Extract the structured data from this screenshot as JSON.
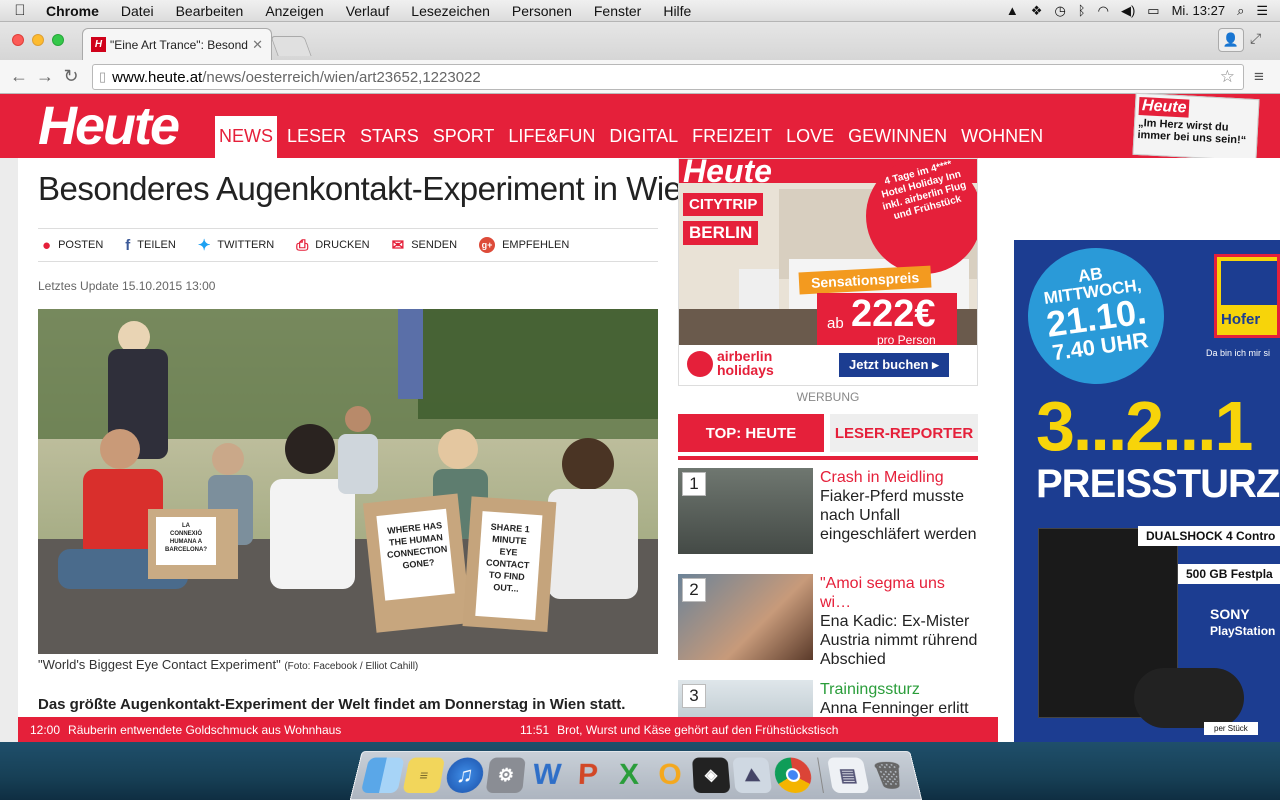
{
  "menubar": {
    "app": "Chrome",
    "items": [
      "Datei",
      "Bearbeiten",
      "Anzeigen",
      "Verlauf",
      "Lesezeichen",
      "Personen",
      "Fenster",
      "Hilfe"
    ],
    "clock": "Mi. 13:27"
  },
  "browser": {
    "tab_title": "\"Eine Art Trance\": Besonder",
    "tab_favicon": "H",
    "url_host": "www.heute.at",
    "url_path": "/news/oesterreich/wien/art23652,1223022"
  },
  "site": {
    "logo": "Heute",
    "nav": [
      "NEWS",
      "LESER",
      "STARS",
      "SPORT",
      "LIFE&FUN",
      "DIGITAL",
      "FREIZEIT",
      "LOVE",
      "GEWINNEN",
      "WOHNEN"
    ],
    "paper_logo": "Heute",
    "paper_headline": "„Im Herz wirst du immer bei uns sein!“"
  },
  "article": {
    "headline": "Besonderes Augenkontakt-Experiment in Wien",
    "share": [
      "POSTEN",
      "TEILEN",
      "TWITTERN",
      "DRUCKEN",
      "SENDEN",
      "EMPFEHLEN"
    ],
    "updated": "Letztes Update 15.10.2015 13:00",
    "caption": "\"World's Biggest Eye Contact Experiment\"",
    "caption_credit": "(Foto: Facebook / Elliot Cahill)",
    "lead": "Das größte Augenkontakt-Experiment der Welt findet am Donnerstag in Wien statt.",
    "signs": [
      "WHERE HAS THE HUMAN CONNECTION GONE?",
      "SHARE 1 MINUTE EYE CONTACT TO FIND OUT...",
      "LA CONNEXIÓ HUMANA A BARCELONA?"
    ]
  },
  "ad1": {
    "brand": "Heute",
    "tag1": "CITYTRIP",
    "tag2": "BERLIN",
    "badge": "4 Tage im 4**** Hotel Holiday Inn inkl. airberlin Flug und Frühstück",
    "price_label": "Sensationspreis",
    "price_prefix": "ab",
    "price": "222€",
    "price_suffix": "pro Person",
    "airline1": "airberlin",
    "airline2": "holidays",
    "cta": "Jetzt buchen ▸"
  },
  "werbung": "WERBUNG",
  "toptabs": {
    "t1": "TOP: HEUTE",
    "t2": "LESER-REPORTER"
  },
  "top": [
    {
      "num": "1",
      "kicker": "Crash in Meidling",
      "headline": "Fiaker-Pferd musste nach Unfall eingeschläfert werden"
    },
    {
      "num": "2",
      "kicker": "\"Amoi segma uns wi…",
      "headline": "Ena Kadic: Ex-Mister Austria nimmt rührend Abschied"
    },
    {
      "num": "3",
      "kicker": "Trainingssturz",
      "headline": "Anna Fenninger erlitt"
    }
  ],
  "ad2": {
    "date_l1": "AB",
    "date_l2": "MITTWOCH,",
    "date_l3": "21.10.",
    "date_l4": "7.40 UHR",
    "brand": "Hofer",
    "slogan": "Da bin ich mir si",
    "countdown": "3...2...1",
    "preissturz": "PREISSTURZ!",
    "feature1": "DUALSHOCK 4 Contro",
    "feature2": "500 GB Festpla",
    "sony": "SONY",
    "playstation": "PlayStation",
    "perstueck": "per Stück"
  },
  "ticker": [
    {
      "time": "12:00",
      "text": "Räuberin entwendete Goldschmuck aus Wohnhaus"
    },
    {
      "time": "11:51",
      "text": "Brot, Wurst und Käse gehört auf den Frühstückstisch"
    }
  ],
  "colors": {
    "brand_red": "#e5203a",
    "ad_blue": "#1c3d91",
    "yellow": "#f7d40a"
  }
}
